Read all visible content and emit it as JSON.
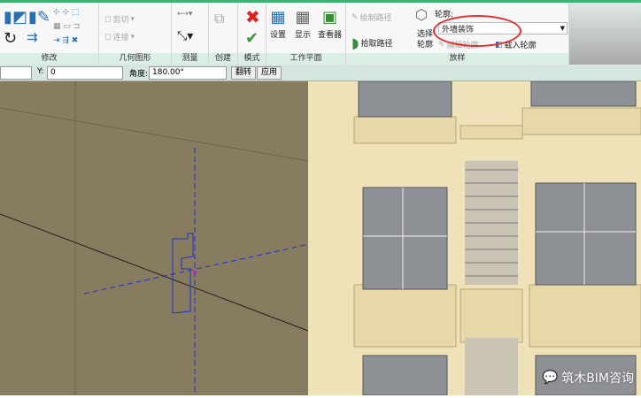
{
  "ribbon": {
    "panels": {
      "modify": "修改",
      "geometry": "几何图形",
      "measure": "测量",
      "create": "创建",
      "mode": "模式",
      "workplane": "工作平面",
      "sweep": "放样"
    },
    "geometry": {
      "cut": "剪切",
      "join": "连接"
    },
    "workplane": {
      "set": "设置",
      "show": "显示",
      "viewer": "查看器"
    },
    "sweep": {
      "sketch_path": "绘制路径",
      "pick_path": "拾取路径",
      "profile_label": "轮廓:",
      "profile_value": "外墙装饰",
      "select_profile": "选择轮廓",
      "edit_profile": "编辑轮廓",
      "load_profile": "载入轮廓"
    }
  },
  "options": {
    "y_label": "Y:",
    "y_value": "0",
    "angle_label": "角度:",
    "angle_value": "180.00°",
    "flip": "翻转",
    "apply": "应用"
  },
  "watermark": "筑木BIM咨询",
  "colors": {
    "accent": "#3cb371",
    "highlight": "#e03030"
  }
}
